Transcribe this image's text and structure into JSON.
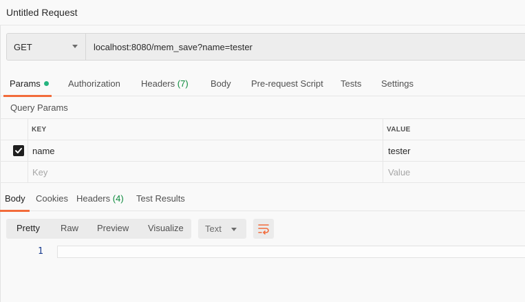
{
  "request": {
    "title": "Untitled Request",
    "method": "GET",
    "url": "localhost:8080/mem_save?name=tester"
  },
  "request_tabs": {
    "params": "Params",
    "authorization": "Authorization",
    "headers": "Headers",
    "headers_count": "(7)",
    "body": "Body",
    "pre_request": "Pre-request Script",
    "tests": "Tests",
    "settings": "Settings"
  },
  "params": {
    "section_label": "Query Params",
    "key_header": "KEY",
    "value_header": "VALUE",
    "rows": [
      {
        "checked": true,
        "key": "name",
        "value": "tester"
      }
    ],
    "key_placeholder": "Key",
    "value_placeholder": "Value"
  },
  "response_tabs": {
    "body": "Body",
    "cookies": "Cookies",
    "headers": "Headers",
    "headers_count": "(4)",
    "test_results": "Test Results"
  },
  "response_toolbar": {
    "views": [
      "Pretty",
      "Raw",
      "Preview",
      "Visualize"
    ],
    "format": "Text",
    "wrap_icon": "wrap-lines-icon"
  },
  "editor": {
    "line_numbers": [
      "1"
    ]
  },
  "colors": {
    "accent": "#f26b3a",
    "status_dot": "#26b47f",
    "count_green": "#0c8a3c",
    "line_number_blue": "#1a3c8f"
  }
}
